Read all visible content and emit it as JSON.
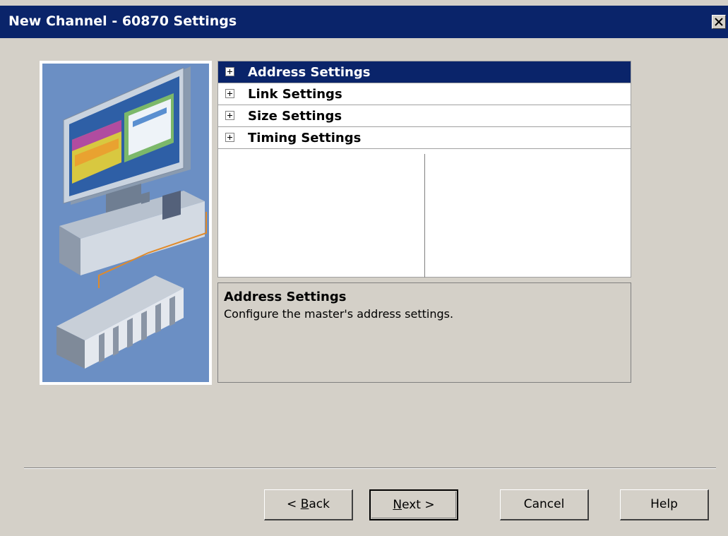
{
  "window": {
    "title": "New Channel - 60870 Settings"
  },
  "tree": {
    "items": [
      {
        "label": "Address Settings",
        "selected": true
      },
      {
        "label": "Link Settings",
        "selected": false
      },
      {
        "label": "Size Settings",
        "selected": false
      },
      {
        "label": "Timing Settings",
        "selected": false
      }
    ]
  },
  "description": {
    "title": "Address Settings",
    "text": "Configure the master's address settings."
  },
  "buttons": {
    "back_arrow": "<",
    "back_mnemonic": "B",
    "back_rest": "ack",
    "next_mnemonic": "N",
    "next_rest": "ext",
    "next_arrow": ">",
    "cancel": "Cancel",
    "help": "Help"
  },
  "colors": {
    "titlebar": "#0a246a",
    "selection": "#0a246a",
    "dialog_bg": "#d4d0c8",
    "illustration_bg": "#6b8fc4"
  },
  "icons": {
    "close": "close-icon",
    "expand": "plus-box-icon",
    "illustration": "computer-plc-illustration"
  }
}
